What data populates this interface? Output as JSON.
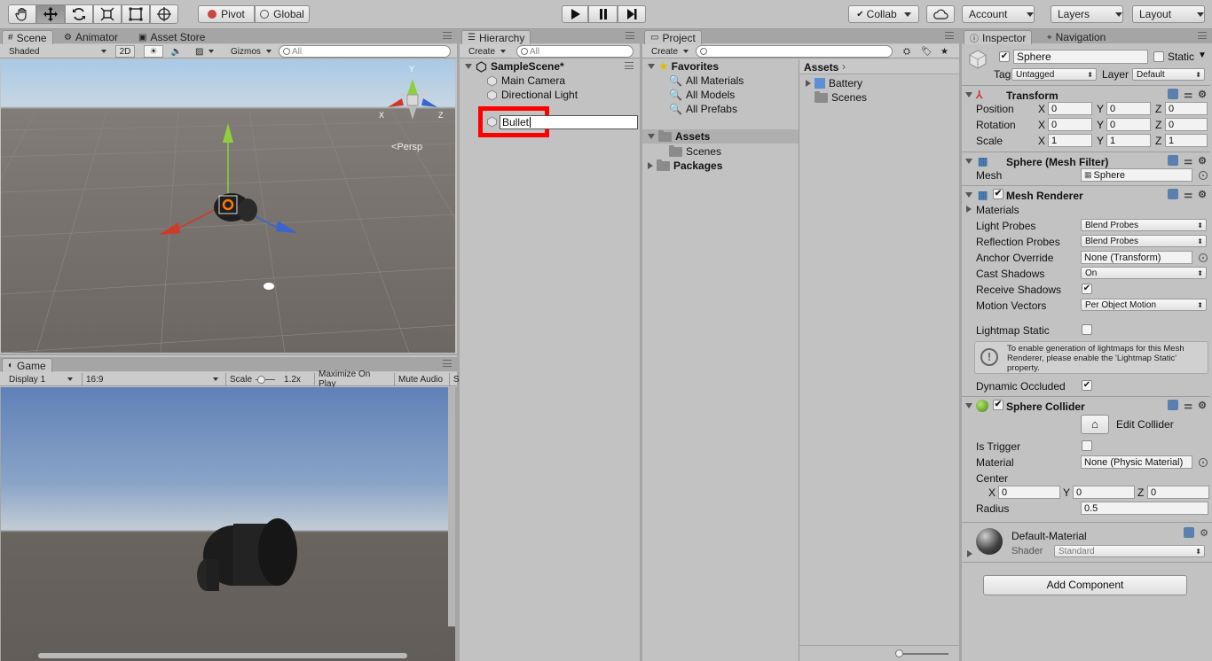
{
  "toolbar": {
    "tools": [
      "hand-tool",
      "move-tool",
      "rotate-tool",
      "scale-tool",
      "rect-tool",
      "transform-tool"
    ],
    "pivot": "Pivot",
    "global": "Global",
    "collab": "Collab",
    "account": "Account",
    "layers": "Layers",
    "layout": "Layout"
  },
  "scene": {
    "tabs": [
      "Scene",
      "Animator",
      "Asset Store"
    ],
    "shading": "Shaded",
    "mode2d": "2D",
    "gizmos": "Gizmos",
    "search_placeholder": "All",
    "persp": "Persp",
    "axes": {
      "x": "X",
      "y": "Y",
      "z": "Z"
    }
  },
  "game": {
    "tab": "Game",
    "display": "Display 1",
    "aspect": "16:9",
    "scale_label": "Scale",
    "scale_value": "1.2x",
    "maximize": "Maximize On Play",
    "mute": "Mute Audio",
    "stats_cut": "S"
  },
  "hierarchy": {
    "tab": "Hierarchy",
    "create": "Create",
    "search_placeholder": "All",
    "scene_name": "SampleScene*",
    "items": [
      "Main Camera",
      "Directional Light"
    ],
    "renaming_value": "Bullet"
  },
  "project": {
    "tab": "Project",
    "create": "Create",
    "favorites": "Favorites",
    "favorite_items": [
      "All Materials",
      "All Models",
      "All Prefabs"
    ],
    "assets": "Assets",
    "asset_children": [
      "Scenes"
    ],
    "packages": "Packages",
    "breadcrumb": "Assets",
    "right_items": [
      "Battery",
      "Scenes"
    ]
  },
  "inspector": {
    "tabs": [
      "Inspector",
      "Navigation"
    ],
    "object_name": "Sphere",
    "static_label": "Static",
    "tag_label": "Tag",
    "tag_value": "Untagged",
    "layer_label": "Layer",
    "layer_value": "Default",
    "transform": {
      "title": "Transform",
      "rows": [
        {
          "label": "Position",
          "x": "0",
          "y": "0",
          "z": "0"
        },
        {
          "label": "Rotation",
          "x": "0",
          "y": "0",
          "z": "0"
        },
        {
          "label": "Scale",
          "x": "1",
          "y": "1",
          "z": "1"
        }
      ]
    },
    "mesh_filter": {
      "title": "Sphere (Mesh Filter)",
      "mesh_label": "Mesh",
      "mesh_value": "Sphere"
    },
    "mesh_renderer": {
      "title": "Mesh Renderer",
      "materials": "Materials",
      "light_probes_label": "Light Probes",
      "light_probes_value": "Blend Probes",
      "reflection_probes_label": "Reflection Probes",
      "reflection_probes_value": "Blend Probes",
      "anchor_override_label": "Anchor Override",
      "anchor_override_value": "None (Transform)",
      "cast_shadows_label": "Cast Shadows",
      "cast_shadows_value": "On",
      "receive_shadows_label": "Receive Shadows",
      "motion_vectors_label": "Motion Vectors",
      "motion_vectors_value": "Per Object Motion",
      "lightmap_static_label": "Lightmap Static",
      "info_text": "To enable generation of lightmaps for this Mesh Renderer, please enable the 'Lightmap Static' property.",
      "dynamic_occluded_label": "Dynamic Occluded"
    },
    "sphere_collider": {
      "title": "Sphere Collider",
      "edit_collider": "Edit Collider",
      "is_trigger_label": "Is Trigger",
      "material_label": "Material",
      "material_value": "None (Physic Material)",
      "center_label": "Center",
      "center": {
        "x": "0",
        "y": "0",
        "z": "0"
      },
      "radius_label": "Radius",
      "radius_value": "0.5"
    },
    "material": {
      "name": "Default-Material",
      "shader_label": "Shader",
      "shader_value": "Standard"
    },
    "add_component": "Add Component"
  },
  "colors": {
    "highlight": "#ff0000",
    "selection": "#8fa4c7",
    "panel": "#c2c2c2"
  }
}
